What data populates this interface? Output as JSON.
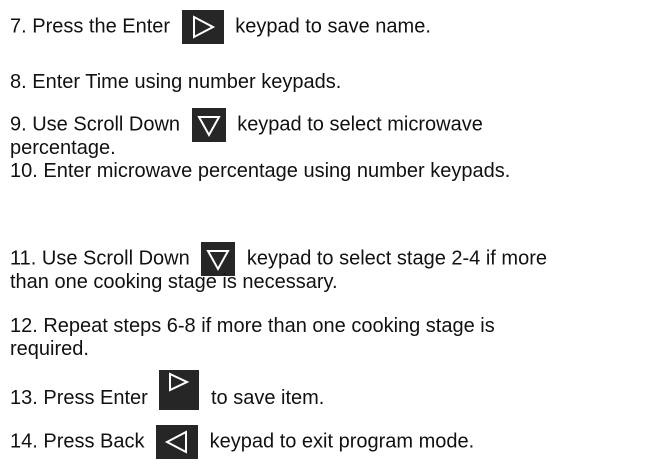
{
  "steps": {
    "s7": {
      "before": "7. Press the Enter",
      "icon": "enter-keypad-icon",
      "after": "keypad to save name."
    },
    "s8": {
      "text": "8. Enter Time using number keypads."
    },
    "s9": {
      "before": "9. Use Scroll Down",
      "icon": "scroll-down-keypad-icon",
      "after": "keypad to select microwave",
      "cont": "percentage."
    },
    "s10": {
      "text": "10. Enter microwave percentage using number keypads."
    },
    "s11": {
      "before": "11. Use Scroll Down",
      "icon": "scroll-down-keypad-icon",
      "after": "keypad to select stage 2-4 if more",
      "cont": "than one cooking stage is necessary."
    },
    "s12": {
      "line1": "12.  Repeat steps 6-8 if more than one cooking stage is",
      "line2": "required."
    },
    "s13": {
      "before": "13. Press Enter",
      "icon": "enter-keypad-icon",
      "after": "to save item."
    },
    "s14": {
      "before": "14. Press Back",
      "icon": "back-keypad-icon",
      "after": "keypad to exit program mode."
    }
  },
  "colors": {
    "keypad_bg": "#262626",
    "keypad_glyph": "#ffffff",
    "text": "#111111"
  }
}
